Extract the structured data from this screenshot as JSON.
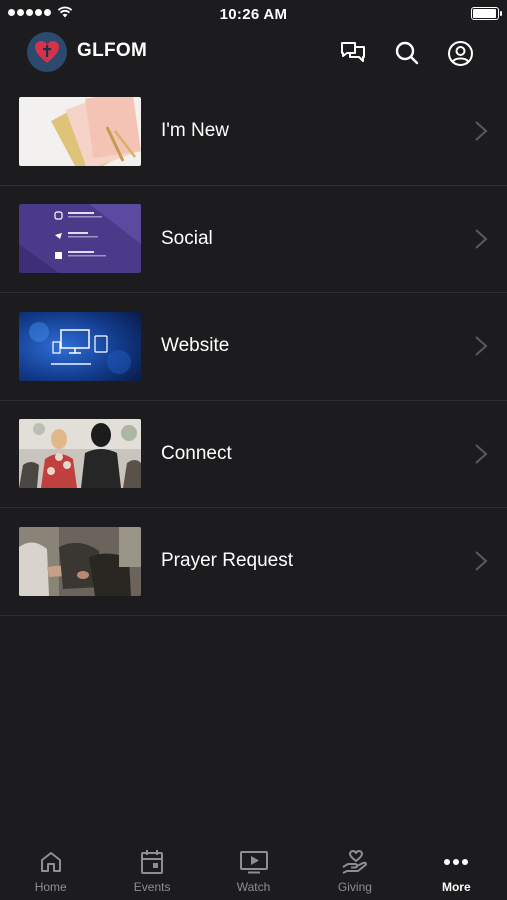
{
  "status_bar": {
    "time": "10:26 AM"
  },
  "header": {
    "title": "GLFOM",
    "icons": [
      "chat-icon",
      "search-icon",
      "profile-icon"
    ]
  },
  "menu": {
    "items": [
      {
        "label": "I'm New",
        "thumbnail": "notebooks-photo"
      },
      {
        "label": "Social",
        "thumbnail": "social-card"
      },
      {
        "label": "Website",
        "thumbnail": "devices-graphic"
      },
      {
        "label": "Connect",
        "thumbnail": "congregation-photo"
      },
      {
        "label": "Prayer Request",
        "thumbnail": "prayer-photo"
      }
    ]
  },
  "tabbar": {
    "active": "More",
    "tabs": [
      {
        "label": "Home",
        "icon": "home-icon"
      },
      {
        "label": "Events",
        "icon": "calendar-icon"
      },
      {
        "label": "Watch",
        "icon": "video-icon"
      },
      {
        "label": "Giving",
        "icon": "giving-icon"
      },
      {
        "label": "More",
        "icon": "more-icon"
      }
    ]
  },
  "colors": {
    "background": "#1c1c1e",
    "divider": "#2e2e31",
    "inactive": "#8e8e93",
    "accent": "#ffffff",
    "logo_bg": "#2b4a6e",
    "logo_heart": "#d6334a"
  }
}
